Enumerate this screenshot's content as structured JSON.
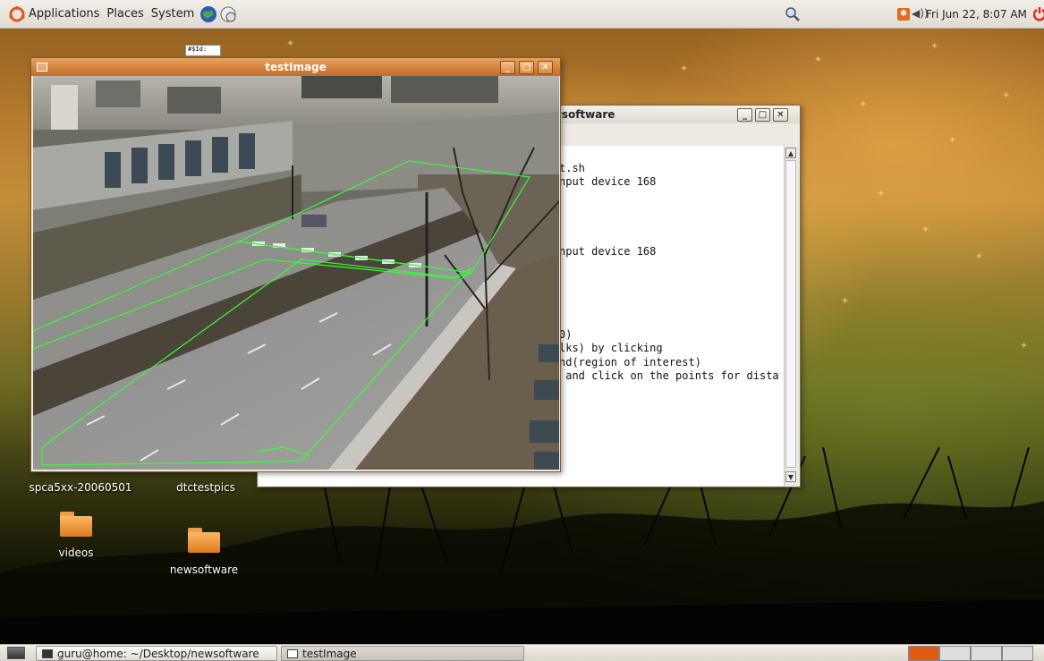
{
  "top_panel": {
    "menus": [
      "Applications",
      "Places",
      "System"
    ],
    "datetime": "Fri Jun 22,  8:07 AM"
  },
  "desktop_icons": [
    {
      "label": "spca5xx-20060501"
    },
    {
      "label": "dtctestpics"
    },
    {
      "label": "videos"
    },
    {
      "label": "newsoftware"
    }
  ],
  "small_file_label": "#$Id:",
  "terminal_window": {
    "title_fragment": "vsoftware",
    "lines": [
      "",
      "t.sh",
      "nput device 168",
      "",
      "",
      "",
      "",
      "nput device 168",
      "",
      "",
      "",
      "",
      "",
      "0)",
      "lks) by clicking",
      "nd(region of interest)",
      " and click on the points for dista"
    ]
  },
  "image_window": {
    "title": "testImage"
  },
  "taskbar": {
    "items": [
      {
        "label": "guru@home: ~/Desktop/newsoftware"
      },
      {
        "label": "testImage"
      }
    ]
  },
  "colors": {
    "active_title": "#c26b26",
    "overlay_lines": "#33ff33"
  },
  "icons": [
    "ubuntu-logo-icon",
    "globe-icon",
    "network-icon",
    "search-icon",
    "update-icon",
    "volume-icon",
    "power-icon",
    "show-desktop-icon",
    "workspace-switcher-icon"
  ]
}
